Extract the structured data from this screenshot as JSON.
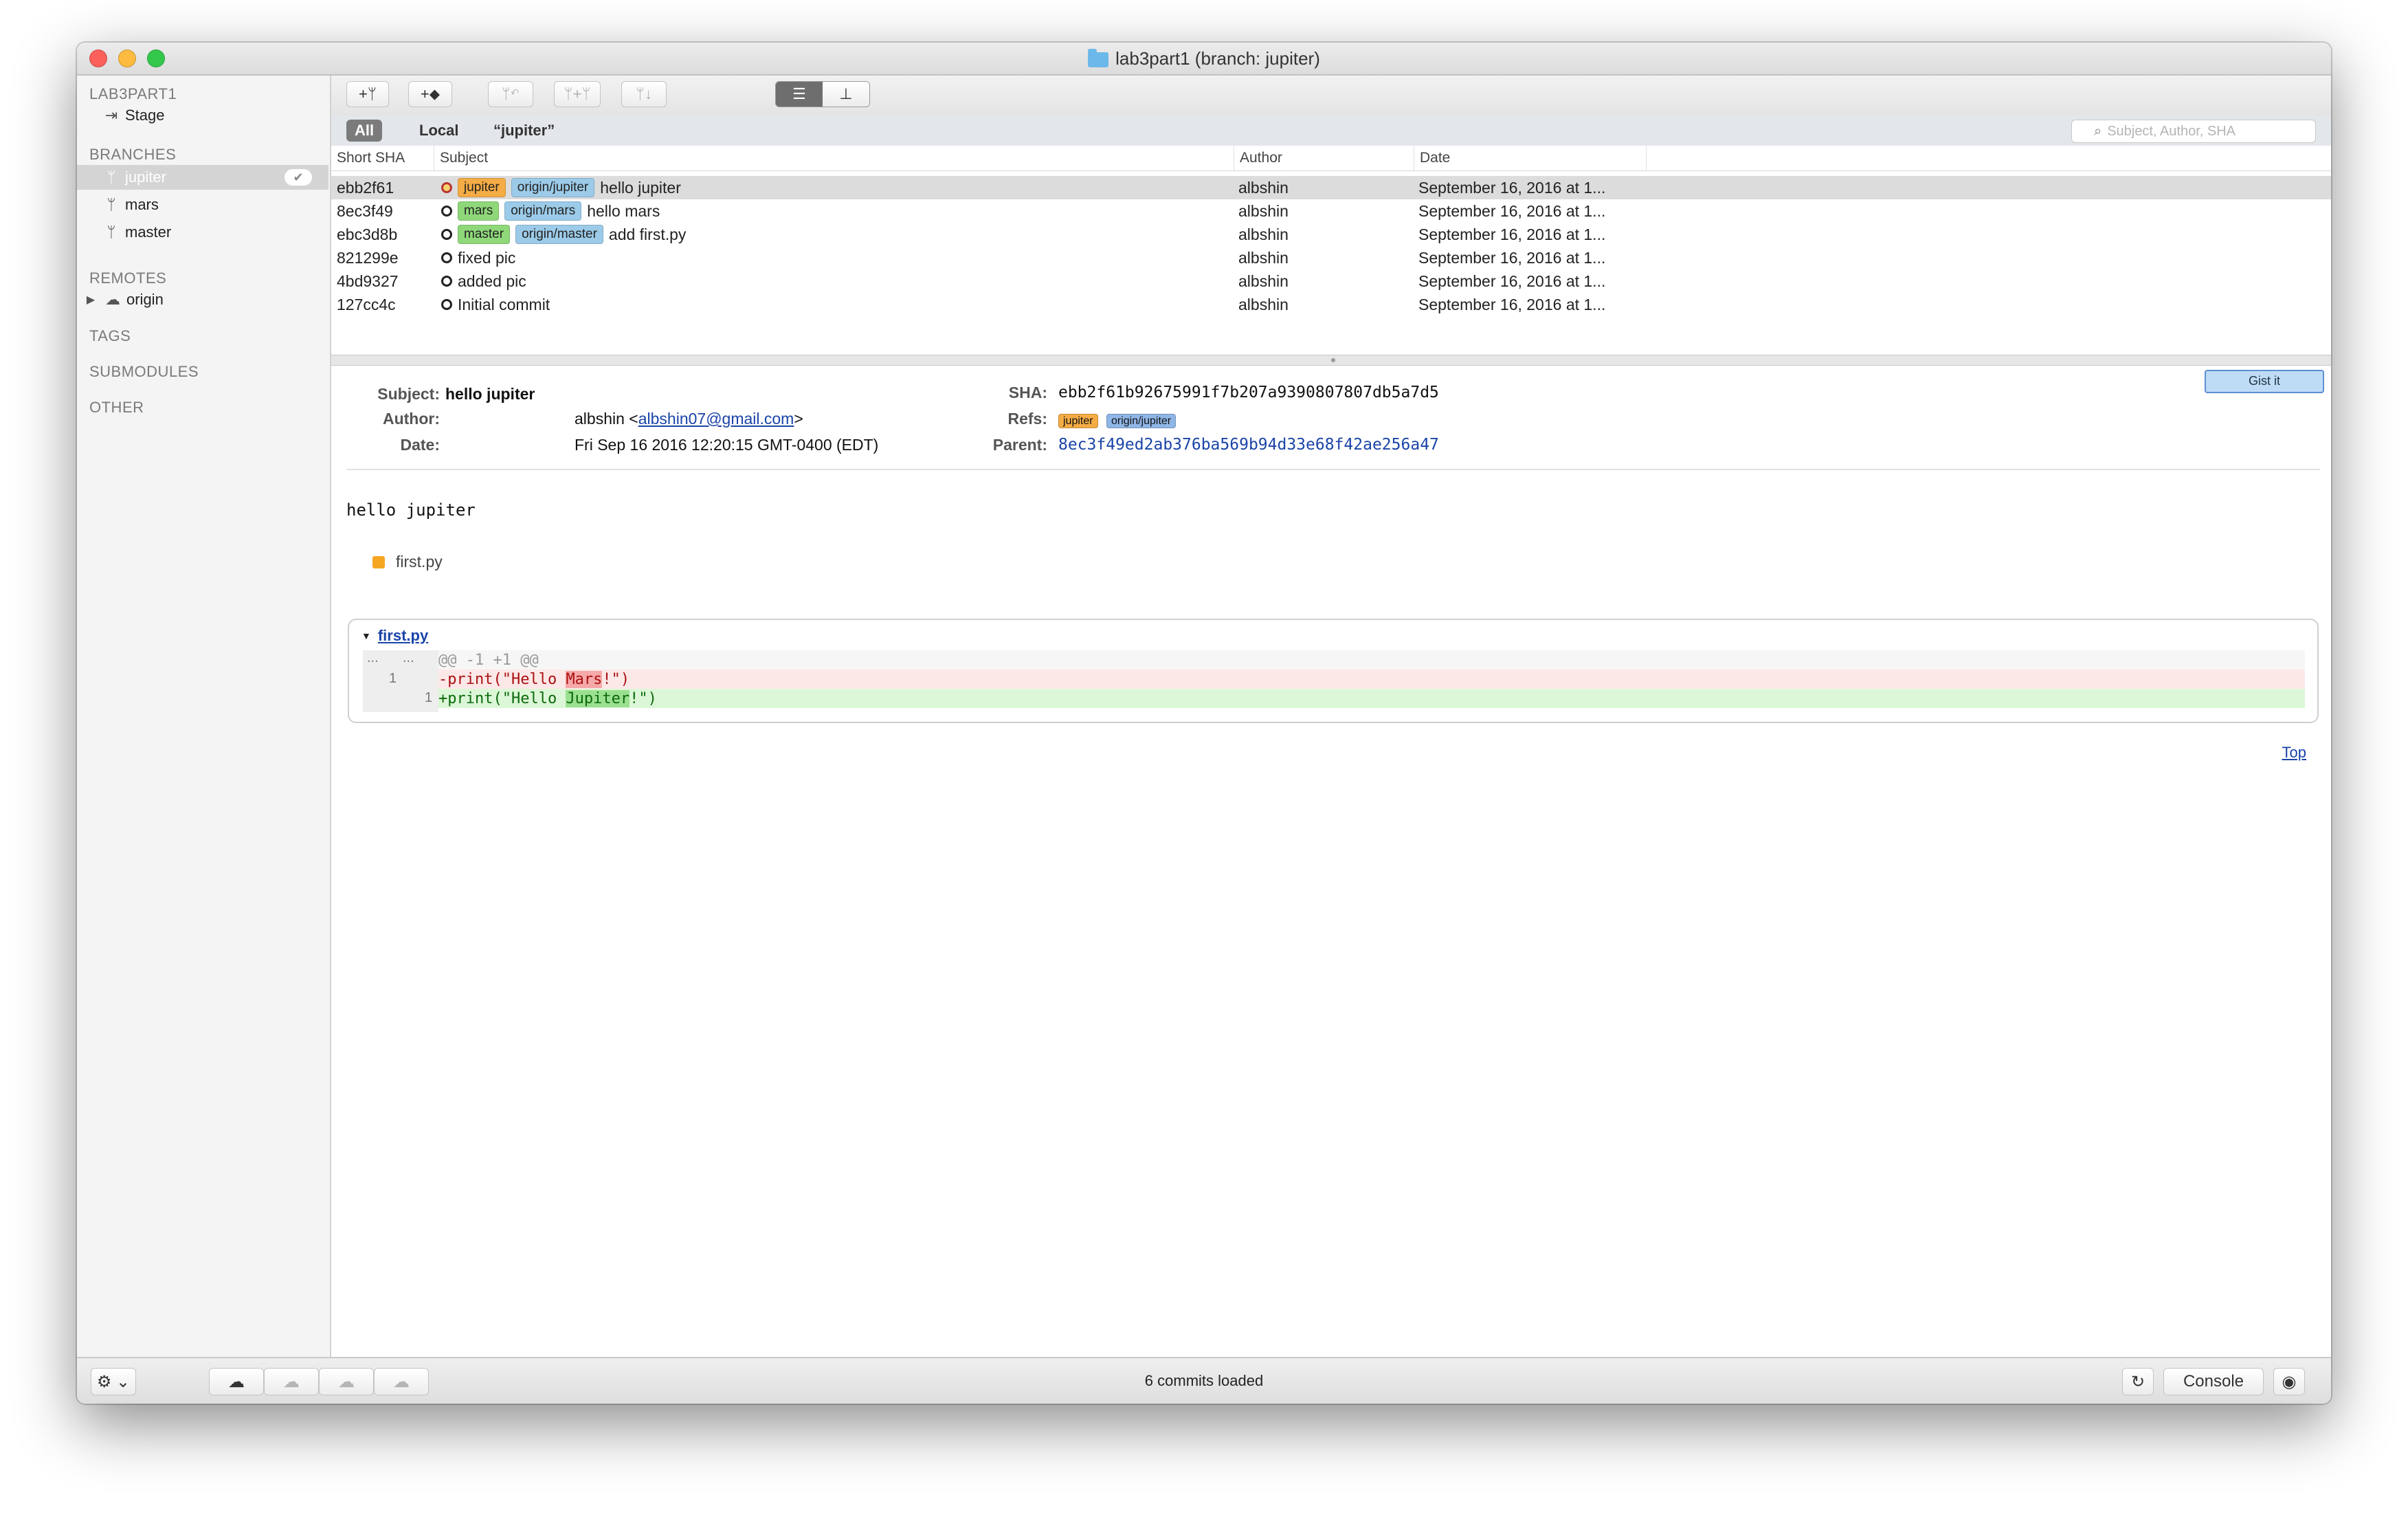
{
  "window": {
    "title": "lab3part1 (branch: jupiter)",
    "traffic_light_colors": [
      "#fc605b",
      "#fdbc40",
      "#34c84a"
    ]
  },
  "sidebar": {
    "repo_label": "LAB3PART1",
    "stage_label": "Stage",
    "branches_header": "BRANCHES",
    "branches": [
      {
        "label": "jupiter",
        "selected": true
      },
      {
        "label": "mars",
        "selected": false
      },
      {
        "label": "master",
        "selected": false
      }
    ],
    "remotes_header": "REMOTES",
    "remotes": [
      {
        "label": "origin"
      }
    ],
    "tags_header": "TAGS",
    "submodules_header": "SUBMODULES",
    "other_header": "OTHER"
  },
  "toolbar": {
    "buttons": [
      {
        "icon": "add-branch-icon",
        "glyph": "+ᛘ"
      },
      {
        "icon": "add-tag-icon",
        "glyph": "+⬥"
      },
      {
        "icon": "merge-icon",
        "glyph": "ᛘ↶",
        "disabled": true
      },
      {
        "icon": "cherry-pick-icon",
        "glyph": "ᛘ+ᛘ",
        "disabled": true
      },
      {
        "icon": "rebase-icon",
        "glyph": "ᛘ↓",
        "disabled": true
      }
    ],
    "view_modes": [
      {
        "icon": "list-view-icon",
        "glyph": "☰",
        "active": true
      },
      {
        "icon": "tree-view-icon",
        "glyph": "⊥",
        "active": false
      }
    ]
  },
  "filters": {
    "items": [
      {
        "label": "All",
        "active": true
      },
      {
        "label": "Local",
        "active": false
      },
      {
        "label": "“jupiter”",
        "active": false
      }
    ],
    "search_placeholder": "Subject, Author, SHA"
  },
  "commits": {
    "columns": [
      "Short SHA",
      "Subject",
      "Author",
      "Date"
    ],
    "rows": [
      {
        "sha": "ebb2f61",
        "refs": [
          {
            "label": "jupiter",
            "color": "orange"
          },
          {
            "label": "origin/jupiter",
            "color": "blue"
          }
        ],
        "subject": "hello jupiter",
        "author": "albshin",
        "date": "September 16, 2016 at 1...",
        "selected": true
      },
      {
        "sha": "8ec3f49",
        "refs": [
          {
            "label": "mars",
            "color": "green"
          },
          {
            "label": "origin/mars",
            "color": "blue"
          }
        ],
        "subject": "hello mars",
        "author": "albshin",
        "date": "September 16, 2016 at 1..."
      },
      {
        "sha": "ebc3d8b",
        "refs": [
          {
            "label": "master",
            "color": "green"
          },
          {
            "label": "origin/master",
            "color": "blue"
          }
        ],
        "subject": "add first.py",
        "author": "albshin",
        "date": "September 16, 2016 at 1..."
      },
      {
        "sha": "821299e",
        "refs": [],
        "subject": "fixed pic",
        "author": "albshin",
        "date": "September 16, 2016 at 1..."
      },
      {
        "sha": "4bd9327",
        "refs": [],
        "subject": "added pic",
        "author": "albshin",
        "date": "September 16, 2016 at 1..."
      },
      {
        "sha": "127cc4c",
        "refs": [],
        "subject": "Initial commit",
        "author": "albshin",
        "date": "September 16, 2016 at 1..."
      }
    ]
  },
  "detail": {
    "subject_label": "Subject:",
    "subject": "hello jupiter",
    "author_label": "Author:",
    "author_name": "albshin <",
    "author_email": "albshin07@gmail.com",
    "author_suffix": ">",
    "date_label": "Date:",
    "date": "Fri Sep 16 2016 12:20:15 GMT-0400 (EDT)",
    "sha_label": "SHA:",
    "sha": "ebb2f61b92675991f7b207a9390807807db5a7d5",
    "refs_label": "Refs:",
    "refs": [
      "jupiter",
      "origin/jupiter"
    ],
    "parent_label": "Parent:",
    "parent": "8ec3f49ed2ab376ba569b94d33e68f42ae256a47",
    "gist_label": "Gist it",
    "message": "hello jupiter",
    "changed_file": "first.py",
    "diff": {
      "file": "first.py",
      "hunk_header": "@@ -1 +1 @@",
      "gutter_old": "...",
      "gutter_new": "...",
      "del_line_no": "1",
      "add_line_no": "1",
      "del_prefix": "-print(\"Hello ",
      "del_highlight": "Mars",
      "del_suffix": "!\")",
      "add_prefix": "+print(\"Hello ",
      "add_highlight": "Jupiter",
      "add_suffix": "!\")"
    },
    "top_link": "Top"
  },
  "bottombar": {
    "status": "6 commits loaded",
    "console_label": "Console",
    "gear_glyph": "⚙ ⌄",
    "refresh_glyph": "↻",
    "inspect_glyph": "◉",
    "cloud_buttons": [
      {
        "icon": "cloud-fetch-icon",
        "glyph": "☁",
        "disabled": false
      },
      {
        "icon": "cloud-pull-icon",
        "glyph": "☁",
        "disabled": true
      },
      {
        "icon": "cloud-push-icon",
        "glyph": "☁",
        "disabled": true
      },
      {
        "icon": "cloud-sync-icon",
        "glyph": "☁",
        "disabled": true
      }
    ]
  }
}
